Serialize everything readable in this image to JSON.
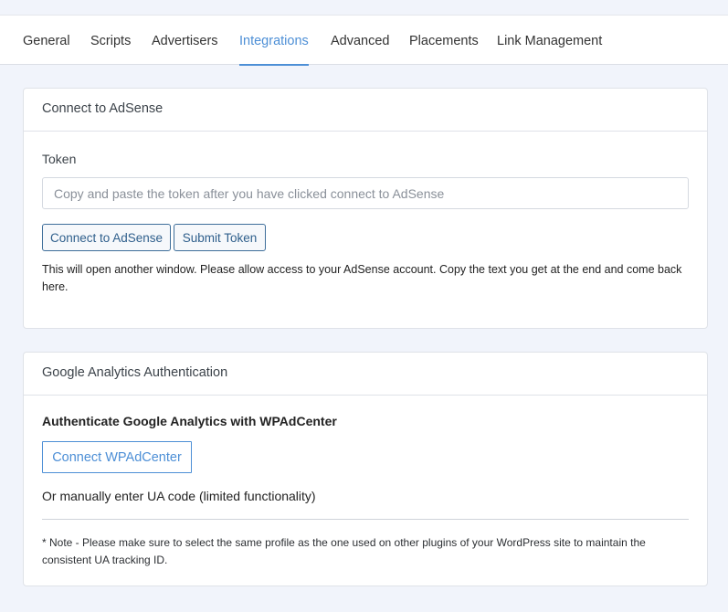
{
  "tabs": [
    "General",
    "Scripts",
    "Advertisers",
    "Integrations",
    "Advanced",
    "Placements",
    "Link Management"
  ],
  "active_tab": "Integrations",
  "adsense": {
    "header": "Connect to AdSense",
    "token_label": "Token",
    "token_placeholder": "Copy and paste the token after you have clicked connect to AdSense",
    "token_value": "",
    "connect_button": "Connect to AdSense",
    "submit_button": "Submit Token",
    "help_text": "This will open another window. Please allow access to your AdSense account. Copy the text you get at the end and come back here."
  },
  "analytics": {
    "header": "Google Analytics Authentication",
    "title": "Authenticate Google Analytics with WPAdCenter",
    "connect_button": "Connect WPAdCenter",
    "manual_text": "Or manually enter UA code (limited functionality)",
    "note": "* Note - Please make sure to select the same profile as the one used on other plugins of your WordPress site to maintain the consistent UA tracking ID."
  },
  "colors": {
    "accent": "#4d8fd6",
    "page_background": "#f1f4fb",
    "button_border": "#3e6e9a"
  }
}
